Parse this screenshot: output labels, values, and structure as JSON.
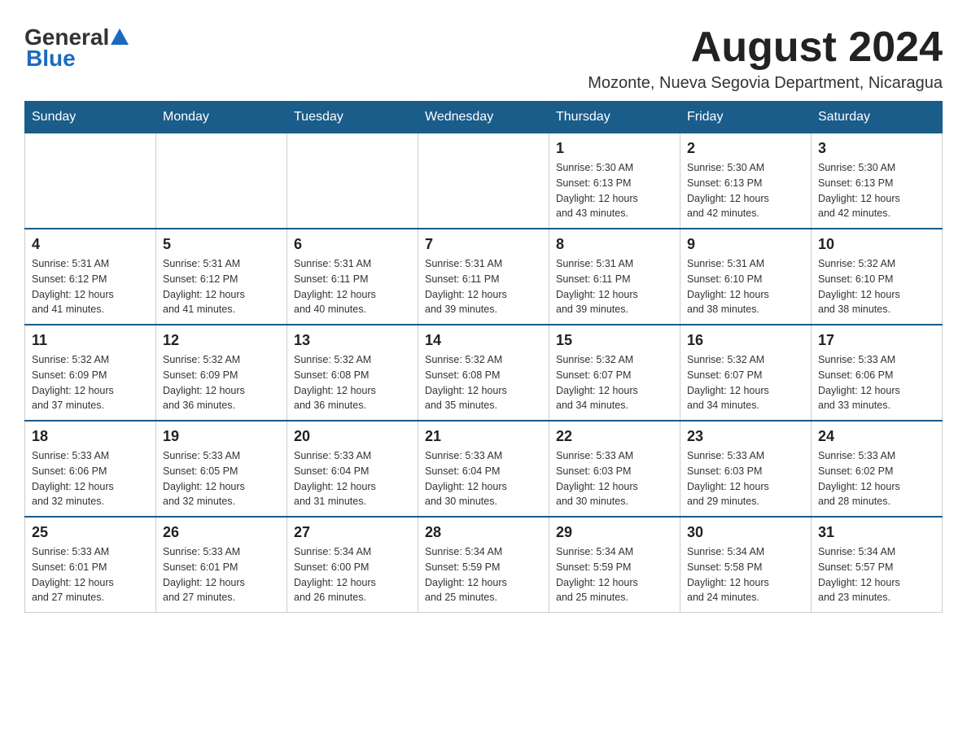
{
  "logo": {
    "general": "General",
    "blue": "Blue",
    "underline": "Blue"
  },
  "header": {
    "month_title": "August 2024",
    "location": "Mozonte, Nueva Segovia Department, Nicaragua"
  },
  "days_of_week": [
    "Sunday",
    "Monday",
    "Tuesday",
    "Wednesday",
    "Thursday",
    "Friday",
    "Saturday"
  ],
  "weeks": [
    [
      {
        "day": "",
        "info": ""
      },
      {
        "day": "",
        "info": ""
      },
      {
        "day": "",
        "info": ""
      },
      {
        "day": "",
        "info": ""
      },
      {
        "day": "1",
        "info": "Sunrise: 5:30 AM\nSunset: 6:13 PM\nDaylight: 12 hours\nand 43 minutes."
      },
      {
        "day": "2",
        "info": "Sunrise: 5:30 AM\nSunset: 6:13 PM\nDaylight: 12 hours\nand 42 minutes."
      },
      {
        "day": "3",
        "info": "Sunrise: 5:30 AM\nSunset: 6:13 PM\nDaylight: 12 hours\nand 42 minutes."
      }
    ],
    [
      {
        "day": "4",
        "info": "Sunrise: 5:31 AM\nSunset: 6:12 PM\nDaylight: 12 hours\nand 41 minutes."
      },
      {
        "day": "5",
        "info": "Sunrise: 5:31 AM\nSunset: 6:12 PM\nDaylight: 12 hours\nand 41 minutes."
      },
      {
        "day": "6",
        "info": "Sunrise: 5:31 AM\nSunset: 6:11 PM\nDaylight: 12 hours\nand 40 minutes."
      },
      {
        "day": "7",
        "info": "Sunrise: 5:31 AM\nSunset: 6:11 PM\nDaylight: 12 hours\nand 39 minutes."
      },
      {
        "day": "8",
        "info": "Sunrise: 5:31 AM\nSunset: 6:11 PM\nDaylight: 12 hours\nand 39 minutes."
      },
      {
        "day": "9",
        "info": "Sunrise: 5:31 AM\nSunset: 6:10 PM\nDaylight: 12 hours\nand 38 minutes."
      },
      {
        "day": "10",
        "info": "Sunrise: 5:32 AM\nSunset: 6:10 PM\nDaylight: 12 hours\nand 38 minutes."
      }
    ],
    [
      {
        "day": "11",
        "info": "Sunrise: 5:32 AM\nSunset: 6:09 PM\nDaylight: 12 hours\nand 37 minutes."
      },
      {
        "day": "12",
        "info": "Sunrise: 5:32 AM\nSunset: 6:09 PM\nDaylight: 12 hours\nand 36 minutes."
      },
      {
        "day": "13",
        "info": "Sunrise: 5:32 AM\nSunset: 6:08 PM\nDaylight: 12 hours\nand 36 minutes."
      },
      {
        "day": "14",
        "info": "Sunrise: 5:32 AM\nSunset: 6:08 PM\nDaylight: 12 hours\nand 35 minutes."
      },
      {
        "day": "15",
        "info": "Sunrise: 5:32 AM\nSunset: 6:07 PM\nDaylight: 12 hours\nand 34 minutes."
      },
      {
        "day": "16",
        "info": "Sunrise: 5:32 AM\nSunset: 6:07 PM\nDaylight: 12 hours\nand 34 minutes."
      },
      {
        "day": "17",
        "info": "Sunrise: 5:33 AM\nSunset: 6:06 PM\nDaylight: 12 hours\nand 33 minutes."
      }
    ],
    [
      {
        "day": "18",
        "info": "Sunrise: 5:33 AM\nSunset: 6:06 PM\nDaylight: 12 hours\nand 32 minutes."
      },
      {
        "day": "19",
        "info": "Sunrise: 5:33 AM\nSunset: 6:05 PM\nDaylight: 12 hours\nand 32 minutes."
      },
      {
        "day": "20",
        "info": "Sunrise: 5:33 AM\nSunset: 6:04 PM\nDaylight: 12 hours\nand 31 minutes."
      },
      {
        "day": "21",
        "info": "Sunrise: 5:33 AM\nSunset: 6:04 PM\nDaylight: 12 hours\nand 30 minutes."
      },
      {
        "day": "22",
        "info": "Sunrise: 5:33 AM\nSunset: 6:03 PM\nDaylight: 12 hours\nand 30 minutes."
      },
      {
        "day": "23",
        "info": "Sunrise: 5:33 AM\nSunset: 6:03 PM\nDaylight: 12 hours\nand 29 minutes."
      },
      {
        "day": "24",
        "info": "Sunrise: 5:33 AM\nSunset: 6:02 PM\nDaylight: 12 hours\nand 28 minutes."
      }
    ],
    [
      {
        "day": "25",
        "info": "Sunrise: 5:33 AM\nSunset: 6:01 PM\nDaylight: 12 hours\nand 27 minutes."
      },
      {
        "day": "26",
        "info": "Sunrise: 5:33 AM\nSunset: 6:01 PM\nDaylight: 12 hours\nand 27 minutes."
      },
      {
        "day": "27",
        "info": "Sunrise: 5:34 AM\nSunset: 6:00 PM\nDaylight: 12 hours\nand 26 minutes."
      },
      {
        "day": "28",
        "info": "Sunrise: 5:34 AM\nSunset: 5:59 PM\nDaylight: 12 hours\nand 25 minutes."
      },
      {
        "day": "29",
        "info": "Sunrise: 5:34 AM\nSunset: 5:59 PM\nDaylight: 12 hours\nand 25 minutes."
      },
      {
        "day": "30",
        "info": "Sunrise: 5:34 AM\nSunset: 5:58 PM\nDaylight: 12 hours\nand 24 minutes."
      },
      {
        "day": "31",
        "info": "Sunrise: 5:34 AM\nSunset: 5:57 PM\nDaylight: 12 hours\nand 23 minutes."
      }
    ]
  ]
}
